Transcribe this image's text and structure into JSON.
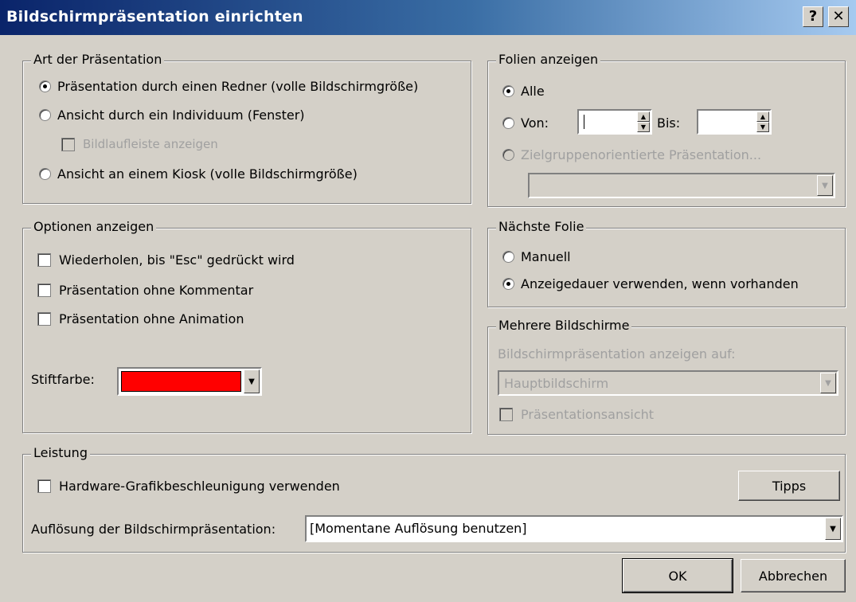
{
  "window": {
    "title": "Bildschirmpräsentation einrichten",
    "help_label": "?",
    "close_label": "✕"
  },
  "art": {
    "legend": "Art der Präsentation",
    "opt_redner": "Präsentation durch einen Redner (volle Bildschirmgröße)",
    "opt_individuum": "Ansicht durch ein Individuum (Fenster)",
    "opt_bildlauf": "Bildlaufleiste anzeigen",
    "opt_kiosk": "Ansicht an einem Kiosk (volle Bildschirmgröße)",
    "selected": "redner"
  },
  "folien": {
    "legend": "Folien anzeigen",
    "opt_alle": "Alle",
    "opt_von": "Von:",
    "bis_label": "Bis:",
    "von_value": "",
    "bis_value": "",
    "opt_ziel": "Zielgruppenorientierte Präsentation...",
    "ziel_value": "",
    "selected": "alle"
  },
  "optionen": {
    "legend": "Optionen anzeigen",
    "loop": "Wiederholen, bis \"Esc\" gedrückt wird",
    "no_comment": "Präsentation ohne Kommentar",
    "no_animation": "Präsentation ohne Animation",
    "pen_label": "Stiftfarbe:",
    "pen_color": "#ff0000"
  },
  "naechste": {
    "legend": "Nächste Folie",
    "opt_manuell": "Manuell",
    "opt_dauer": "Anzeigedauer verwenden, wenn vorhanden",
    "selected": "dauer"
  },
  "mehrere": {
    "legend": "Mehrere Bildschirme",
    "show_on_label": "Bildschirmpräsentation anzeigen auf:",
    "monitor_value": "Hauptbildschirm",
    "presenter_view": "Präsentationsansicht"
  },
  "leistung": {
    "legend": "Leistung",
    "hw_accel": "Hardware-Grafikbeschleunigung verwenden",
    "tips_button": "Tipps",
    "resolution_label": "Auflösung der Bildschirmpräsentation:",
    "resolution_value": "[Momentane Auflösung benutzen]"
  },
  "buttons": {
    "ok": "OK",
    "cancel": "Abbrechen"
  },
  "icons": {
    "dropdown": "chevron-down-icon",
    "spin_up": "spin-up-icon",
    "spin_down": "spin-down-icon",
    "help": "help-icon",
    "close": "close-icon"
  }
}
